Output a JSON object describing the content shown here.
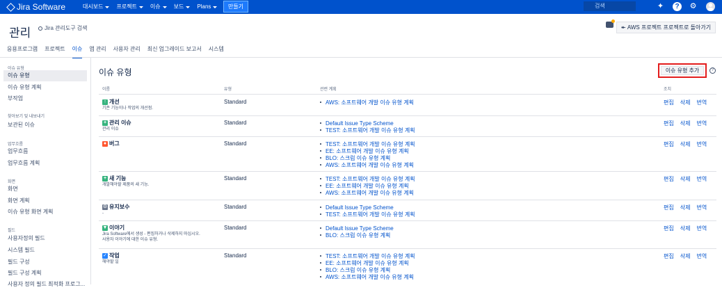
{
  "topbar": {
    "logo": "Jira Software",
    "nav": [
      "대시보드",
      "프로젝트",
      "이슈",
      "보드",
      "Plans"
    ],
    "create": "만들기",
    "search_placeholder": "검색"
  },
  "header": {
    "title": "관리",
    "admin_search": "Jira 관리도구 검색",
    "aws_back": "AWS 프로젝트 프로젝트로 돌아가기"
  },
  "tabs": [
    "응용프로그램",
    "프로젝트",
    "이슈",
    "앱 관리",
    "사용자 관리",
    "최신 업그레이드 보고서",
    "시스템"
  ],
  "sidebar": {
    "section_issue_types": "이슈 유형",
    "issue_types": "이슈 유형",
    "issue_type_schemes": "이슈 유형 계획",
    "subtasks": "부작업",
    "section_search": "찾아보기 및 내보내기",
    "archived": "보관된 이슈",
    "section_workflows": "업무흐름",
    "workflows": "업무흐름",
    "workflow_schemes": "업무흐름 계획",
    "section_screens": "화면",
    "screens": "화면",
    "screen_schemes": "화면 계획",
    "issue_type_screen_schemes": "이슈 유형 화면 계획",
    "section_fields": "필드",
    "custom_fields": "사용자정의 필드",
    "system_fields": "시스템 필드",
    "field_config": "필드 구성",
    "field_config_schemes": "필드 구성 계획",
    "priority_more": "사용자 정의 필드 최적화 프로그..."
  },
  "main": {
    "title": "이슈 유형",
    "add_button": "이슈 유형 추가",
    "columns": {
      "name": "이름",
      "type": "유형",
      "schemes": "관련 계획",
      "ops": "조치"
    },
    "ops": {
      "edit": "편집",
      "delete": "삭제",
      "translate": "번역"
    }
  },
  "rows": [
    {
      "name": "개선",
      "desc": [
        "기존 기능이나 작업의 개선점."
      ],
      "type": "Standard",
      "icon": "improvement-icon",
      "color": "#36b37e",
      "schemes": [
        "AWS: 소프트웨어 개발 이슈 유형 계획"
      ]
    },
    {
      "name": "관리 이슈",
      "desc": [
        "관리 이슈"
      ],
      "type": "Standard",
      "icon": "new-feature-icon",
      "color": "#36b37e",
      "schemes": [
        "Default Issue Type Scheme",
        "TEST: 소프트웨어 개발 이슈 유형 계획"
      ]
    },
    {
      "name": "버그",
      "desc": [
        ""
      ],
      "type": "Standard",
      "icon": "bug-icon",
      "color": "#ff5630",
      "schemes": [
        "TEST: 소프트웨어 개발 이슈 유형 계획",
        "EE: 소프트웨어 개발 이슈 유형 계획",
        "BLO: 스크럼 이슈 유형 계획",
        "AWS: 소프트웨어 개발 이슈 유형 계획"
      ]
    },
    {
      "name": "새 기능",
      "desc": [
        "개발해야할 제품의 새 기능."
      ],
      "type": "Standard",
      "icon": "new-feature-icon",
      "color": "#36b37e",
      "schemes": [
        "TEST: 소프트웨어 개발 이슈 유형 계획",
        "EE: 소프트웨어 개발 이슈 유형 계획",
        "AWS: 소프트웨어 개발 이슈 유형 계획"
      ]
    },
    {
      "name": "유지보수",
      "desc": [
        "-"
      ],
      "type": "Standard",
      "icon": "maintenance-icon",
      "color": "#6b778c",
      "schemes": [
        "Default Issue Type Scheme",
        "TEST: 소프트웨어 개발 이슈 유형 계획"
      ]
    },
    {
      "name": "이야기",
      "desc": [
        "Jira Software에서 생성 - 편집하거나 삭제하지 마십시오.",
        "사용자 이야기에 대한 이슈 유형."
      ],
      "type": "Standard",
      "icon": "story-icon",
      "color": "#36b37e",
      "schemes": [
        "Default Issue Type Scheme",
        "BLO: 스크럼 이슈 유형 계획"
      ]
    },
    {
      "name": "작업",
      "desc": [
        "해야할 일"
      ],
      "type": "Standard",
      "icon": "task-icon",
      "color": "#2684ff",
      "schemes": [
        "TEST: 소프트웨어 개발 이슈 유형 계획",
        "EE: 소프트웨어 개발 이슈 유형 계획",
        "BLO: 스크럼 이슈 유형 계획",
        "AWS: 소프트웨어 개발 이슈 유형 계획"
      ]
    }
  ]
}
